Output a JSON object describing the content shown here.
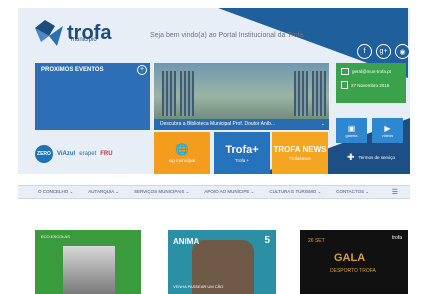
{
  "header": {
    "logo_text": "trofa",
    "logo_sub": "município",
    "welcome": "Seja bem vindo(a) ao Portal Institucional da Trofa",
    "social": [
      "f",
      "g+",
      "rss"
    ]
  },
  "events": {
    "title": "PROXIMOS EVENTOS",
    "plus": "+"
  },
  "library": {
    "caption": "Descubra a Biblioteca Municipal Prof. Doutor Aníb...",
    "chev": "⌄"
  },
  "contact": {
    "email": "geral@mun-trofa.pt",
    "date": "27 Novembro 2015"
  },
  "partners": {
    "zero": "ZERO",
    "viazul": "ViAzul",
    "erapet": "erapet",
    "fru": "FRU"
  },
  "tiles": {
    "sig": {
      "big": "🌐",
      "label": "sig municipal"
    },
    "trofa": {
      "big": "Trofa+",
      "label": "Trofa +"
    },
    "news": {
      "big": "TROFA NEWS",
      "label": "TrofaNews"
    },
    "galeria": "galeria",
    "videos": "videos",
    "termos": "Termos de serviço"
  },
  "nav": {
    "items": [
      "O CONCELHO ⌄",
      "AUTARQUIA ⌄",
      "SERVIÇOS MUNICIPAIS ⌄",
      "APOIO AO MUNÍCIPE ⌄",
      "CULTURA E TURISMO ⌄",
      "CONTACTOS ⌄"
    ],
    "menu": "☰"
  },
  "cards": {
    "c1": {
      "head": "ECO-ESCOLAS"
    },
    "c2": {
      "title": "ANIMA",
      "num": "5",
      "caption": "VENHA PASSEAR UM CÃO"
    },
    "c3": {
      "date": "26 SET",
      "gala": "GALA",
      "sub": "DESPORTO TROFA",
      "logo": "trofa"
    }
  }
}
